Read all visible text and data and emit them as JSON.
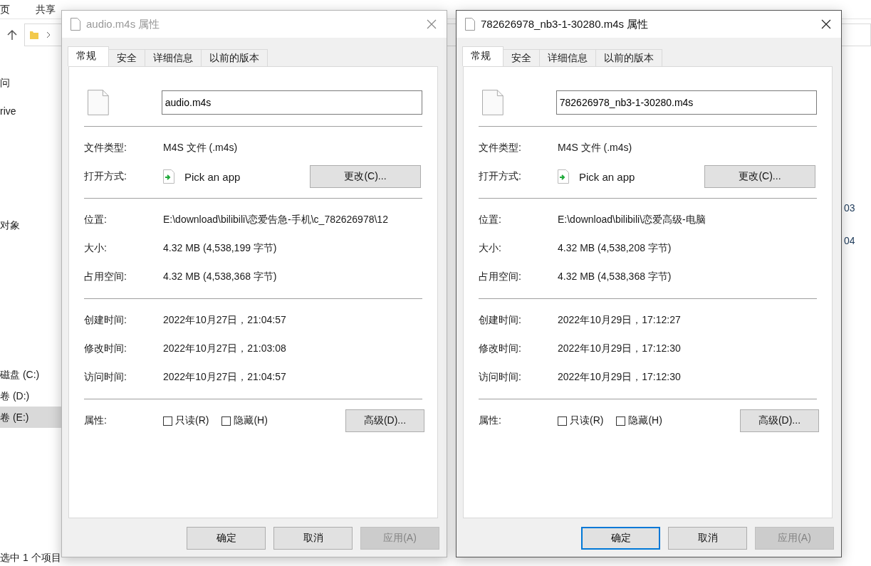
{
  "explorer": {
    "ribbon_tabs": [
      "页",
      "共享"
    ],
    "sidebar": [
      {
        "label": "问",
        "selected": false
      },
      {
        "label": "rive",
        "selected": false
      },
      {
        "label": "对象",
        "selected": false
      },
      {
        "label": "磁盘 (C:)",
        "selected": false
      },
      {
        "label": "卷 (D:)",
        "selected": false
      },
      {
        "label": "卷 (E:)",
        "selected": true
      }
    ],
    "column_fragments": [
      "03",
      "04"
    ],
    "status_bar": {
      "selection": "选中 1 个项目"
    }
  },
  "dialogs": [
    {
      "title": "audio.m4s 属性",
      "active": false,
      "tabs": [
        {
          "label": "常规",
          "selected": true
        },
        {
          "label": "安全",
          "selected": false
        },
        {
          "label": "详细信息",
          "selected": false
        },
        {
          "label": "以前的版本",
          "selected": false
        }
      ],
      "file_name": "audio.m4s",
      "sections": [
        [
          {
            "kind": "text",
            "label": "文件类型:",
            "value": "M4S 文件 (.m4s)"
          },
          {
            "kind": "app",
            "label": "打开方式:",
            "value": "Pick an app",
            "button": "更改(C)..."
          }
        ],
        [
          {
            "kind": "text",
            "label": "位置:",
            "value": "E:\\download\\bilibili\\恋爱告急-手机\\c_782626978\\12"
          },
          {
            "kind": "text",
            "label": "大小:",
            "value": "4.32 MB (4,538,199 字节)"
          },
          {
            "kind": "text",
            "label": "占用空间:",
            "value": "4.32 MB (4,538,368 字节)"
          }
        ],
        [
          {
            "kind": "text",
            "label": "创建时间:",
            "value": "2022年10月27日，21:04:57"
          },
          {
            "kind": "text",
            "label": "修改时间:",
            "value": "2022年10月27日，21:03:08"
          },
          {
            "kind": "text",
            "label": "访问时间:",
            "value": "2022年10月27日，21:04:57"
          }
        ],
        [
          {
            "kind": "attributes",
            "label": "属性:",
            "checkboxes": [
              {
                "label": "只读(R)",
                "checked": false
              },
              {
                "label": "隐藏(H)",
                "checked": false
              }
            ],
            "button": "高级(D)..."
          }
        ]
      ],
      "buttons": [
        {
          "label": "确定",
          "default": false,
          "disabled": false
        },
        {
          "label": "取消",
          "default": false,
          "disabled": false
        },
        {
          "label": "应用(A)",
          "default": false,
          "disabled": true
        }
      ]
    },
    {
      "title": "782626978_nb3-1-30280.m4s 属性",
      "active": true,
      "tabs": [
        {
          "label": "常规",
          "selected": true
        },
        {
          "label": "安全",
          "selected": false
        },
        {
          "label": "详细信息",
          "selected": false
        },
        {
          "label": "以前的版本",
          "selected": false
        }
      ],
      "file_name": "782626978_nb3-1-30280.m4s",
      "sections": [
        [
          {
            "kind": "text",
            "label": "文件类型:",
            "value": "M4S 文件 (.m4s)"
          },
          {
            "kind": "app",
            "label": "打开方式:",
            "value": "Pick an app",
            "button": "更改(C)..."
          }
        ],
        [
          {
            "kind": "text",
            "label": "位置:",
            "value": "E:\\download\\bilibili\\恋爱高级-电脑"
          },
          {
            "kind": "text",
            "label": "大小:",
            "value": "4.32 MB (4,538,208 字节)"
          },
          {
            "kind": "text",
            "label": "占用空间:",
            "value": "4.32 MB (4,538,368 字节)"
          }
        ],
        [
          {
            "kind": "text",
            "label": "创建时间:",
            "value": "2022年10月29日，17:12:27"
          },
          {
            "kind": "text",
            "label": "修改时间:",
            "value": "2022年10月29日，17:12:30"
          },
          {
            "kind": "text",
            "label": "访问时间:",
            "value": "2022年10月29日，17:12:30"
          }
        ],
        [
          {
            "kind": "attributes",
            "label": "属性:",
            "checkboxes": [
              {
                "label": "只读(R)",
                "checked": false
              },
              {
                "label": "隐藏(H)",
                "checked": false
              }
            ],
            "button": "高级(D)..."
          }
        ]
      ],
      "buttons": [
        {
          "label": "确定",
          "default": true,
          "disabled": false
        },
        {
          "label": "取消",
          "default": false,
          "disabled": false
        },
        {
          "label": "应用(A)",
          "default": false,
          "disabled": true
        }
      ]
    }
  ]
}
